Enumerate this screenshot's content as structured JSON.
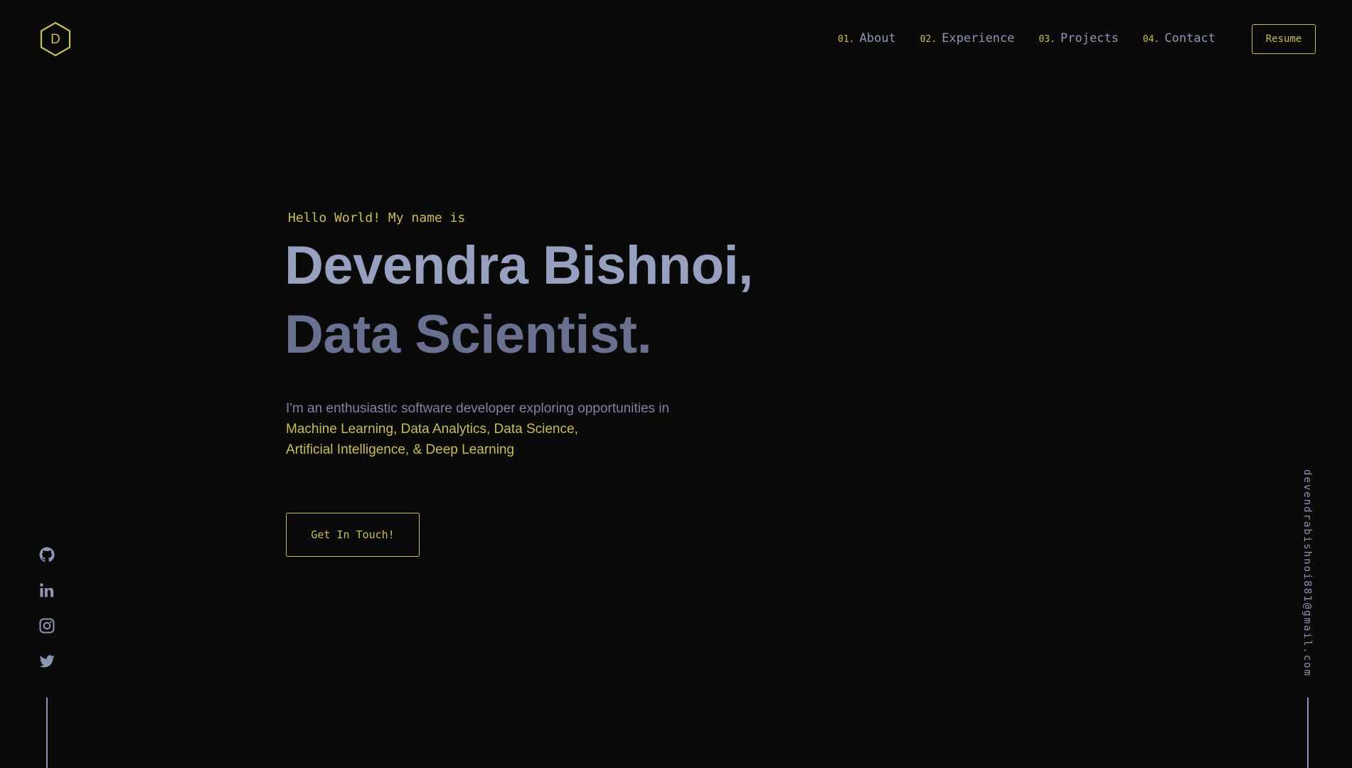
{
  "header": {
    "logo": {
      "letter": "D",
      "icon": "hexagon-logo-icon"
    },
    "nav": [
      {
        "num": "01.",
        "label": "About"
      },
      {
        "num": "02.",
        "label": "Experience"
      },
      {
        "num": "03.",
        "label": "Projects"
      },
      {
        "num": "04.",
        "label": "Contact"
      }
    ],
    "resume_label": "Resume"
  },
  "hero": {
    "greeting": "Hello World! My name is",
    "name": "Devendra Bishnoi,",
    "role": "Data Scientist.",
    "intro_muted": "I'm an enthusiastic software developer exploring opportunities in",
    "intro_accent_1": "Machine Learning, Data Analytics, Data Science,",
    "intro_accent_2": "Artificial Intelligence, & Deep Learning",
    "cta_label": "Get In Touch!"
  },
  "social": [
    {
      "icon": "github-icon"
    },
    {
      "icon": "linkedin-icon"
    },
    {
      "icon": "instagram-icon"
    },
    {
      "icon": "twitter-icon"
    }
  ],
  "email": "devendrabishnoi881@gmail.com",
  "colors": {
    "background": "#0a0a0b",
    "accent": "#c9bd5a",
    "text_primary": "#98a0c0",
    "text_secondary": "#6a7190",
    "text_muted": "#8f96b4"
  }
}
